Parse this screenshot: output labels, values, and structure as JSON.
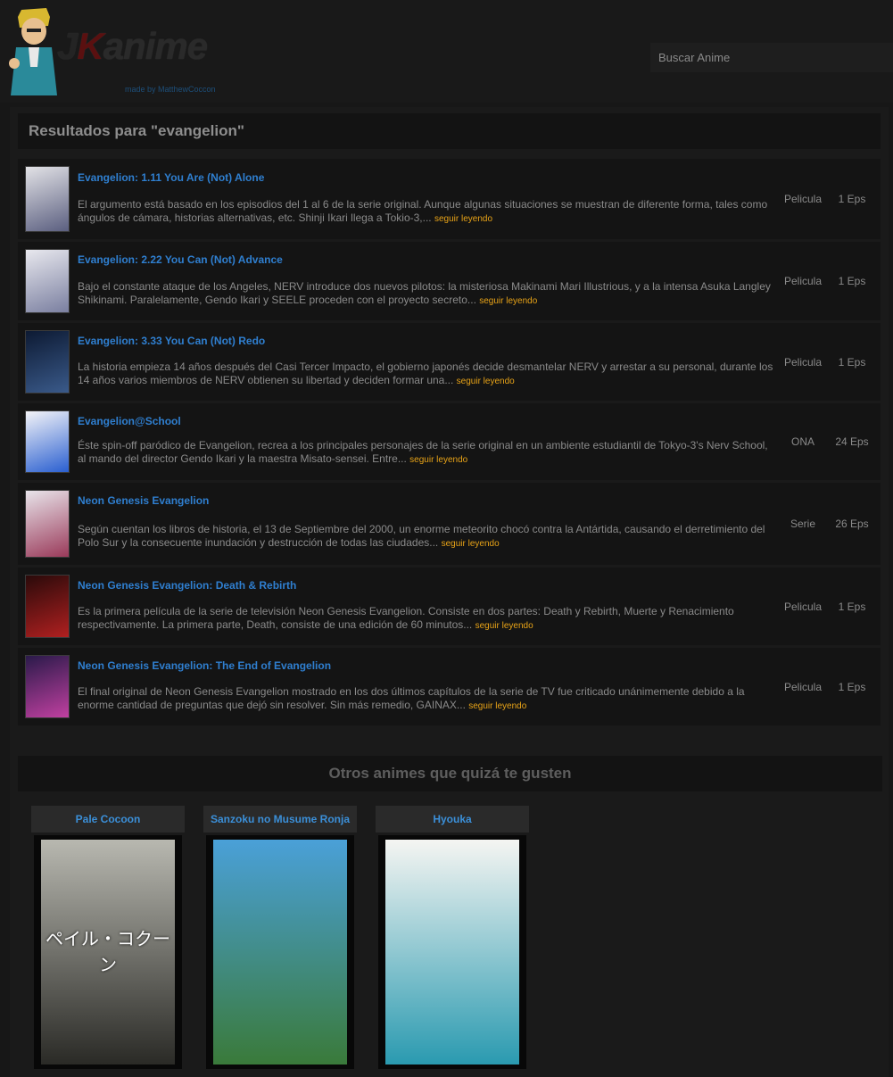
{
  "header": {
    "logo_text": "JKanime",
    "madeby": "made by MatthewCoccon",
    "search_placeholder": "Buscar Anime"
  },
  "results": {
    "title": "Resultados para \"evangelion\"",
    "more_label": "seguir leyendo",
    "items": [
      {
        "title": "Evangelion: 1.11 You Are (Not) Alone",
        "desc": "El argumento está basado en los episodios del 1 al 6 de la serie original. Aunque algunas situaciones se muestran de diferente forma, tales como ángulos de cámara, historias alternativas, etc. Shinji Ikari llega a Tokio-3,...",
        "type": "Pelicula",
        "eps": "1 Eps",
        "thumb_colors": [
          "#e2e2e6",
          "#5b5f80"
        ]
      },
      {
        "title": "Evangelion: 2.22 You Can (Not) Advance",
        "desc": "Bajo el constante ataque de los Angeles, NERV introduce dos nuevos pilotos: la misteriosa Makinami Mari Illustrious, y a la intensa Asuka Langley Shikinami. Paralelamente, Gendo Ikari y SEELE proceden con el proyecto secreto...",
        "type": "Pelicula",
        "eps": "1 Eps",
        "thumb_colors": [
          "#e8e8ee",
          "#7a7fa0"
        ]
      },
      {
        "title": "Evangelion: 3.33 You Can (Not) Redo",
        "desc": "La historia empieza 14 años después del Casi Tercer Impacto, el gobierno japonés decide desmantelar NERV y arrestar a su personal, durante los 14 años varios miembros de NERV obtienen su libertad y deciden formar una...",
        "type": "Pelicula",
        "eps": "1 Eps",
        "thumb_colors": [
          "#0d1a33",
          "#3a5a8a"
        ]
      },
      {
        "title": "Evangelion@School",
        "desc": "Éste spin-off paródico de Evangelion, recrea a los principales personajes de la serie original en un ambiente estudiantil de Tokyo-3's Nerv School, al mando del director Gendo Ikari y la maestra Misato-sensei. Entre...",
        "type": "ONA",
        "eps": "24 Eps",
        "thumb_colors": [
          "#f4f4f8",
          "#2a5fd0"
        ]
      },
      {
        "title": "Neon Genesis Evangelion",
        "desc": "Según cuentan los libros de historia, el 13 de Septiembre del 2000, un enorme meteorito chocó contra la Antártida, causando el derretimiento del Polo Sur y la consecuente inundación y destrucción de todas las ciudades...",
        "type": "Serie",
        "eps": "26 Eps",
        "thumb_colors": [
          "#e8e4ea",
          "#9a3a5a"
        ]
      },
      {
        "title": "Neon Genesis Evangelion: Death & Rebirth",
        "desc": "Es la primera película de la serie de televisión Neon Genesis Evangelion. Consiste en dos partes: Death y Rebirth, Muerte y Renacimiento respectivamente. La primera parte, Death, consiste de una edición de 60 minutos...",
        "type": "Pelicula",
        "eps": "1 Eps",
        "thumb_colors": [
          "#2a0a0a",
          "#b02020"
        ]
      },
      {
        "title": "Neon Genesis Evangelion: The End of Evangelion",
        "desc": "El final original de Neon Genesis Evangelion mostrado en los dos últimos capítulos de la serie de TV fue criticado unánimemente debido a la enorme cantidad de preguntas que dejó sin resolver. Sin más remedio, GAINAX...",
        "type": "Pelicula",
        "eps": "1 Eps",
        "thumb_colors": [
          "#2a1a4a",
          "#c040a0"
        ]
      }
    ]
  },
  "recommend": {
    "title": "Otros animes que quizá te gusten",
    "items": [
      {
        "title": "Pale Cocoon",
        "poster_text": "ペイル・コクーン",
        "poster_colors": [
          "#b8b8b0",
          "#2a2a26"
        ]
      },
      {
        "title": "Sanzoku no Musume Ronja",
        "poster_colors": [
          "#4aa0d8",
          "#3a7a3a"
        ]
      },
      {
        "title": "Hyouka",
        "poster_colors": [
          "#f5f5f2",
          "#2a9ab0"
        ]
      }
    ]
  },
  "colors": {
    "background": "#171717",
    "link": "#2f7fd0",
    "more_link": "#e8a317"
  }
}
